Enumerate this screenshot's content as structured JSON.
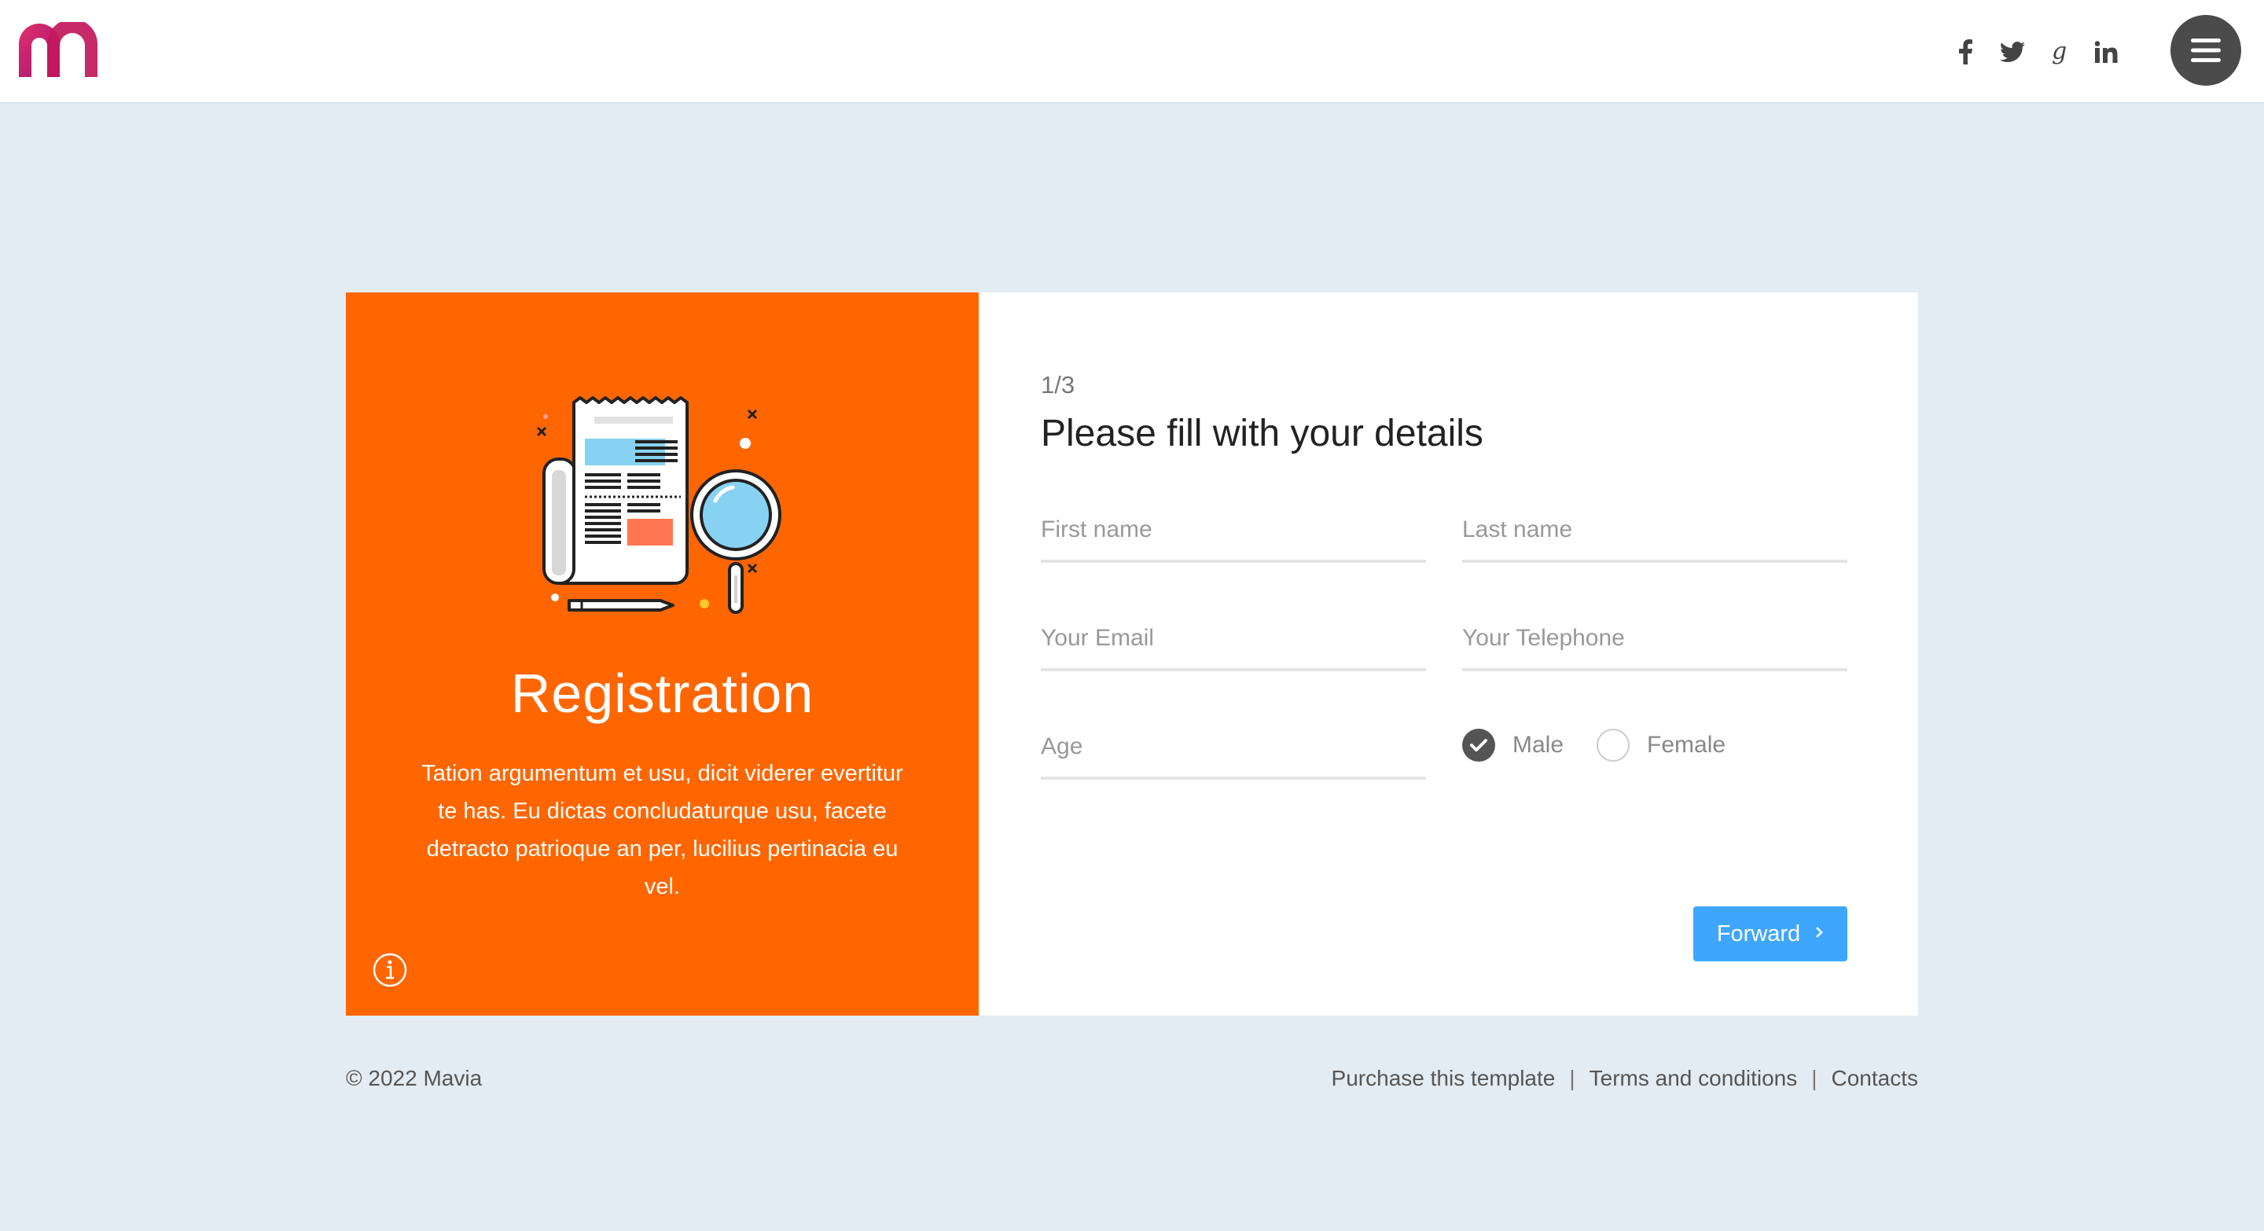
{
  "header": {
    "social": [
      "facebook-icon",
      "twitter-icon",
      "google-plus-icon",
      "linkedin-icon"
    ],
    "menu_icon": "hamburger-icon"
  },
  "colors": {
    "accent_orange": "#ff6600",
    "button_blue": "#3ea6ff",
    "logo_pink": "#c2185b",
    "background": "#e3ecf2"
  },
  "left_panel": {
    "title": "Registration",
    "text": "Tation argumentum et usu, dicit viderer evertitur te has. Eu dictas concludaturque usu, facete detracto patrioque an per, lucilius pertinacia eu vel.",
    "info_icon": "info-icon"
  },
  "form": {
    "step": "1/3",
    "title": "Please fill with your details",
    "first_name_placeholder": "First name",
    "last_name_placeholder": "Last name",
    "email_placeholder": "Your Email",
    "telephone_placeholder": "Your Telephone",
    "age_placeholder": "Age",
    "gender": {
      "options": [
        "Male",
        "Female"
      ],
      "selected": "Male"
    },
    "forward_label": "Forward"
  },
  "footer": {
    "copyright": "© 2022 Mavia",
    "links": [
      "Purchase this template",
      "Terms and conditions",
      "Contacts"
    ],
    "separator": "|"
  }
}
